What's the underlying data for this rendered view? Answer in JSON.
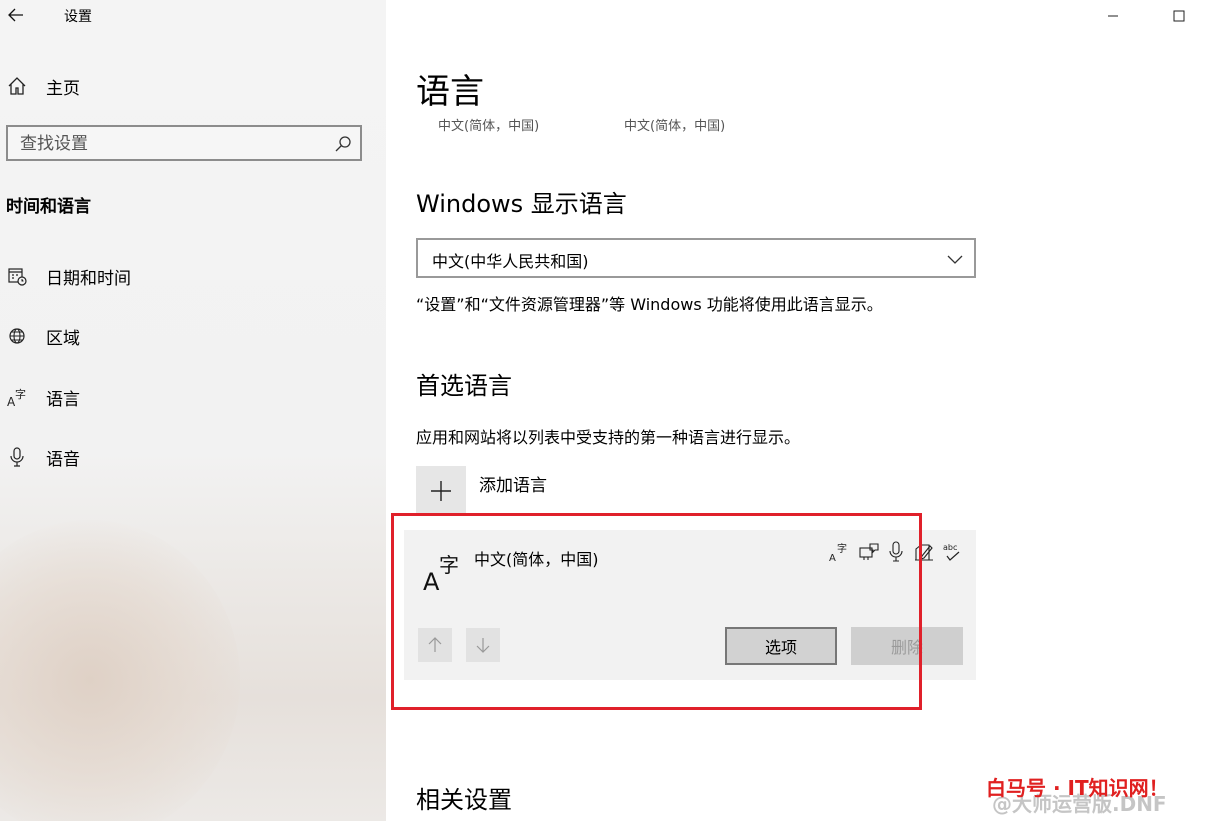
{
  "app": {
    "title": "设置"
  },
  "sidebar": {
    "home_label": "主页",
    "search": {
      "placeholder": "查找设置"
    },
    "section_title": "时间和语言",
    "items": [
      {
        "label": "日期和时间",
        "icon": "calendar-clock-icon"
      },
      {
        "label": "区域",
        "icon": "globe-icon"
      },
      {
        "label": "语言",
        "icon": "language-icon"
      },
      {
        "label": "语音",
        "icon": "microphone-icon"
      }
    ]
  },
  "main": {
    "title": "语言",
    "crumbs": [
      "中文(简体，中国)",
      "中文(简体，中国)"
    ],
    "display_language": {
      "heading": "Windows 显示语言",
      "selected": "中文(中华人民共和国)",
      "description": "“设置”和“文件资源管理器”等 Windows 功能将使用此语言显示。"
    },
    "preferred": {
      "heading": "首选语言",
      "description": "应用和网站将以列表中受支持的第一种语言进行显示。",
      "add_label": "添加语言",
      "languages": [
        {
          "name": "中文(简体，中国)",
          "features": [
            "display-language-icon",
            "text-to-speech-icon",
            "speech-recognition-icon",
            "handwriting-icon",
            "spell-check-icon"
          ],
          "options_label": "选项",
          "remove_label": "删除"
        }
      ]
    },
    "related_heading": "相关设置"
  },
  "watermark": {
    "main": "白马号 · IT知识网！",
    "sub": "@大师运营版.DNF"
  },
  "colors": {
    "highlight": "#e0202a",
    "card": "#f2f2f2"
  }
}
